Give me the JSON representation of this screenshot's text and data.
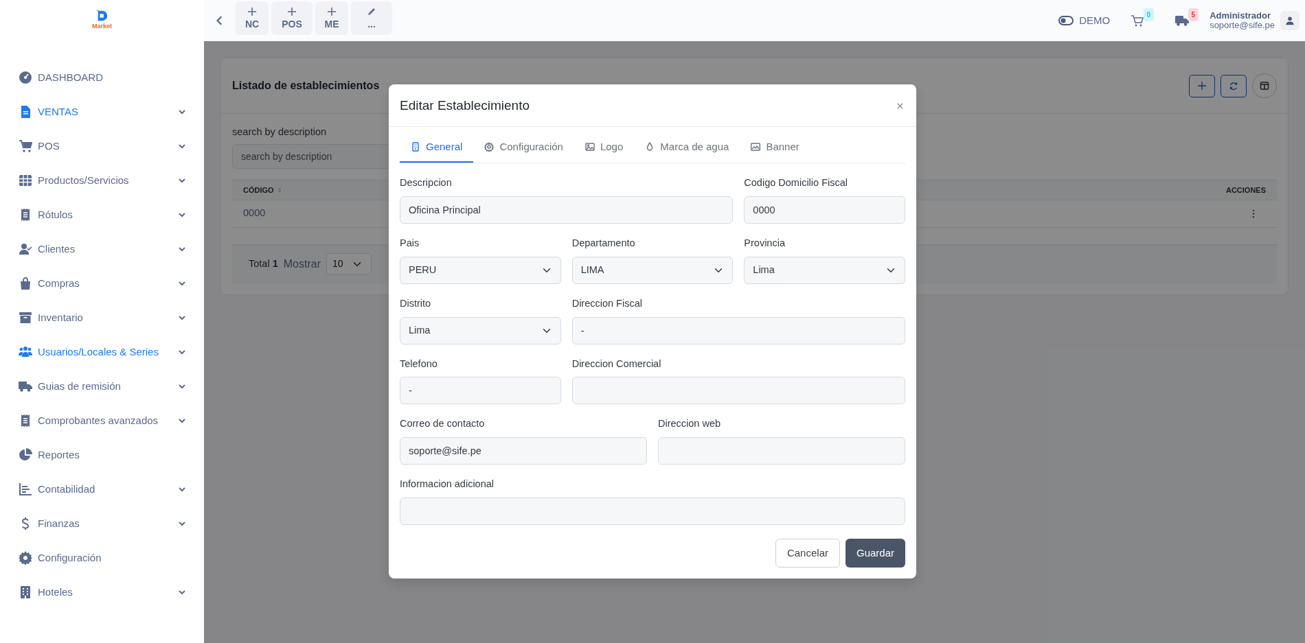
{
  "logo": {
    "text": "Market"
  },
  "topbar": {
    "quick_actions": [
      {
        "kind": "add",
        "label": "NC"
      },
      {
        "kind": "add",
        "label": "POS"
      },
      {
        "kind": "add",
        "label": "ME"
      },
      {
        "kind": "edit",
        "label": "..."
      }
    ],
    "mode": {
      "label": "DEMO"
    },
    "cart_badge": "0",
    "shipments_badge": "5",
    "user": {
      "name": "Administrador",
      "email": "soporte@sife.pe"
    }
  },
  "sidebar": {
    "items": [
      {
        "label": "DASHBOARD",
        "active": false,
        "has_submenu": false
      },
      {
        "label": "VENTAS",
        "active": true,
        "has_submenu": true
      },
      {
        "label": "POS",
        "active": false,
        "has_submenu": true
      },
      {
        "label": "Productos/Servicios",
        "active": false,
        "has_submenu": true
      },
      {
        "label": "Rótulos",
        "active": false,
        "has_submenu": true
      },
      {
        "label": "Clientes",
        "active": false,
        "has_submenu": true
      },
      {
        "label": "Compras",
        "active": false,
        "has_submenu": true
      },
      {
        "label": "Inventario",
        "active": false,
        "has_submenu": true
      },
      {
        "label": "Usuarios/Locales & Series",
        "active": true,
        "has_submenu": true
      },
      {
        "label": "Guias de remisión",
        "active": false,
        "has_submenu": true
      },
      {
        "label": "Comprobantes avanzados",
        "active": false,
        "has_submenu": true
      },
      {
        "label": "Reportes",
        "active": false,
        "has_submenu": false
      },
      {
        "label": "Contabilidad",
        "active": false,
        "has_submenu": true
      },
      {
        "label": "Finanzas",
        "active": false,
        "has_submenu": true
      },
      {
        "label": "Configuración",
        "active": false,
        "has_submenu": false
      },
      {
        "label": "Hoteles",
        "active": false,
        "has_submenu": true
      }
    ]
  },
  "page": {
    "title": "Listado de establecimientos",
    "search": {
      "label": "search by description",
      "placeholder": "search by description"
    },
    "table": {
      "columns": [
        "CÓDIGO",
        "ACCIONES"
      ],
      "rows": [
        [
          "0000"
        ]
      ]
    },
    "footer": {
      "total": "Total **1**",
      "show_label": "Mostrar",
      "page_size": "10"
    }
  },
  "modal": {
    "title": "Editar Establecimiento",
    "tabs": [
      {
        "label": "General",
        "selected": true
      },
      {
        "label": "Configuración",
        "selected": false
      },
      {
        "label": "Logo",
        "selected": false
      },
      {
        "label": "Marca de agua",
        "selected": false
      },
      {
        "label": "Banner",
        "selected": false
      }
    ],
    "form_rows": [
      [
        {
          "label": "Descripcion",
          "kind": "input",
          "value": "Oficina Principal"
        },
        {
          "label": "Codigo Domicilio Fiscal",
          "kind": "input",
          "value": "0000"
        }
      ],
      [
        {
          "label": "Pais",
          "kind": "select",
          "value": "PERU"
        },
        {
          "label": "Departamento",
          "kind": "select",
          "value": "LIMA"
        },
        {
          "label": "Provincia",
          "kind": "select",
          "value": "Lima"
        }
      ],
      [
        {
          "label": "Distrito",
          "kind": "select",
          "value": "Lima"
        },
        {
          "label": "Direccion Fiscal",
          "kind": "input",
          "value": "-"
        }
      ],
      [
        {
          "label": "Telefono",
          "kind": "input",
          "value": "-"
        },
        {
          "label": "Direccion Comercial",
          "kind": "input"
        }
      ],
      [
        {
          "label": "Correo de contacto",
          "kind": "input",
          "value": "soporte@sife.pe"
        },
        {
          "label": "Direccion web",
          "kind": "input"
        }
      ],
      [
        {
          "label": "Informacion adicional",
          "kind": "input"
        }
      ]
    ],
    "buttons": [
      {
        "kind": "secondary",
        "label": "Cancelar"
      },
      {
        "kind": "primary",
        "label": "Guardar"
      }
    ]
  }
}
